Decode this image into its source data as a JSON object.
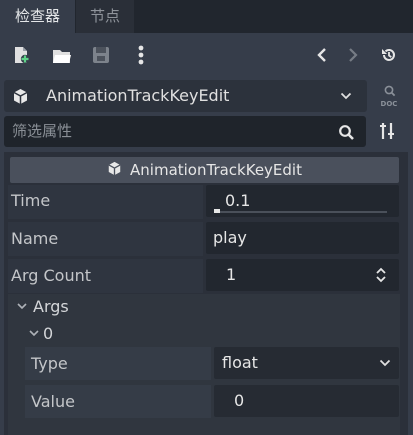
{
  "tabs": [
    {
      "label": "检查器"
    },
    {
      "label": "节点"
    }
  ],
  "object": {
    "name": "AnimationTrackKeyEdit"
  },
  "filter": {
    "placeholder": "筛选属性"
  },
  "section": {
    "title": "AnimationTrackKeyEdit"
  },
  "properties": {
    "time": {
      "label": "Time",
      "value": "0.1"
    },
    "name": {
      "label": "Name",
      "value": "play"
    },
    "arg_count": {
      "label": "Arg Count",
      "value": "1"
    },
    "args": {
      "label": "Args",
      "item": {
        "label": "0",
        "type": {
          "label": "Type",
          "value": "float"
        },
        "value": {
          "label": "Value",
          "value": "0"
        }
      }
    }
  },
  "colors": {
    "background": "#363d4a",
    "tab_bar": "#21262e",
    "panel": "#2b303a",
    "field": "#22272f",
    "section_header": "#4a505c"
  },
  "icons": [
    "new-resource-icon",
    "open-folder-icon",
    "save-icon",
    "more-options-icon",
    "back-icon",
    "forward-icon",
    "history-icon",
    "object-cube-icon",
    "dropdown-arrow-icon",
    "doc-icon",
    "search-icon",
    "tools-icon",
    "spinner-icon",
    "collapse-arrow-icon"
  ]
}
